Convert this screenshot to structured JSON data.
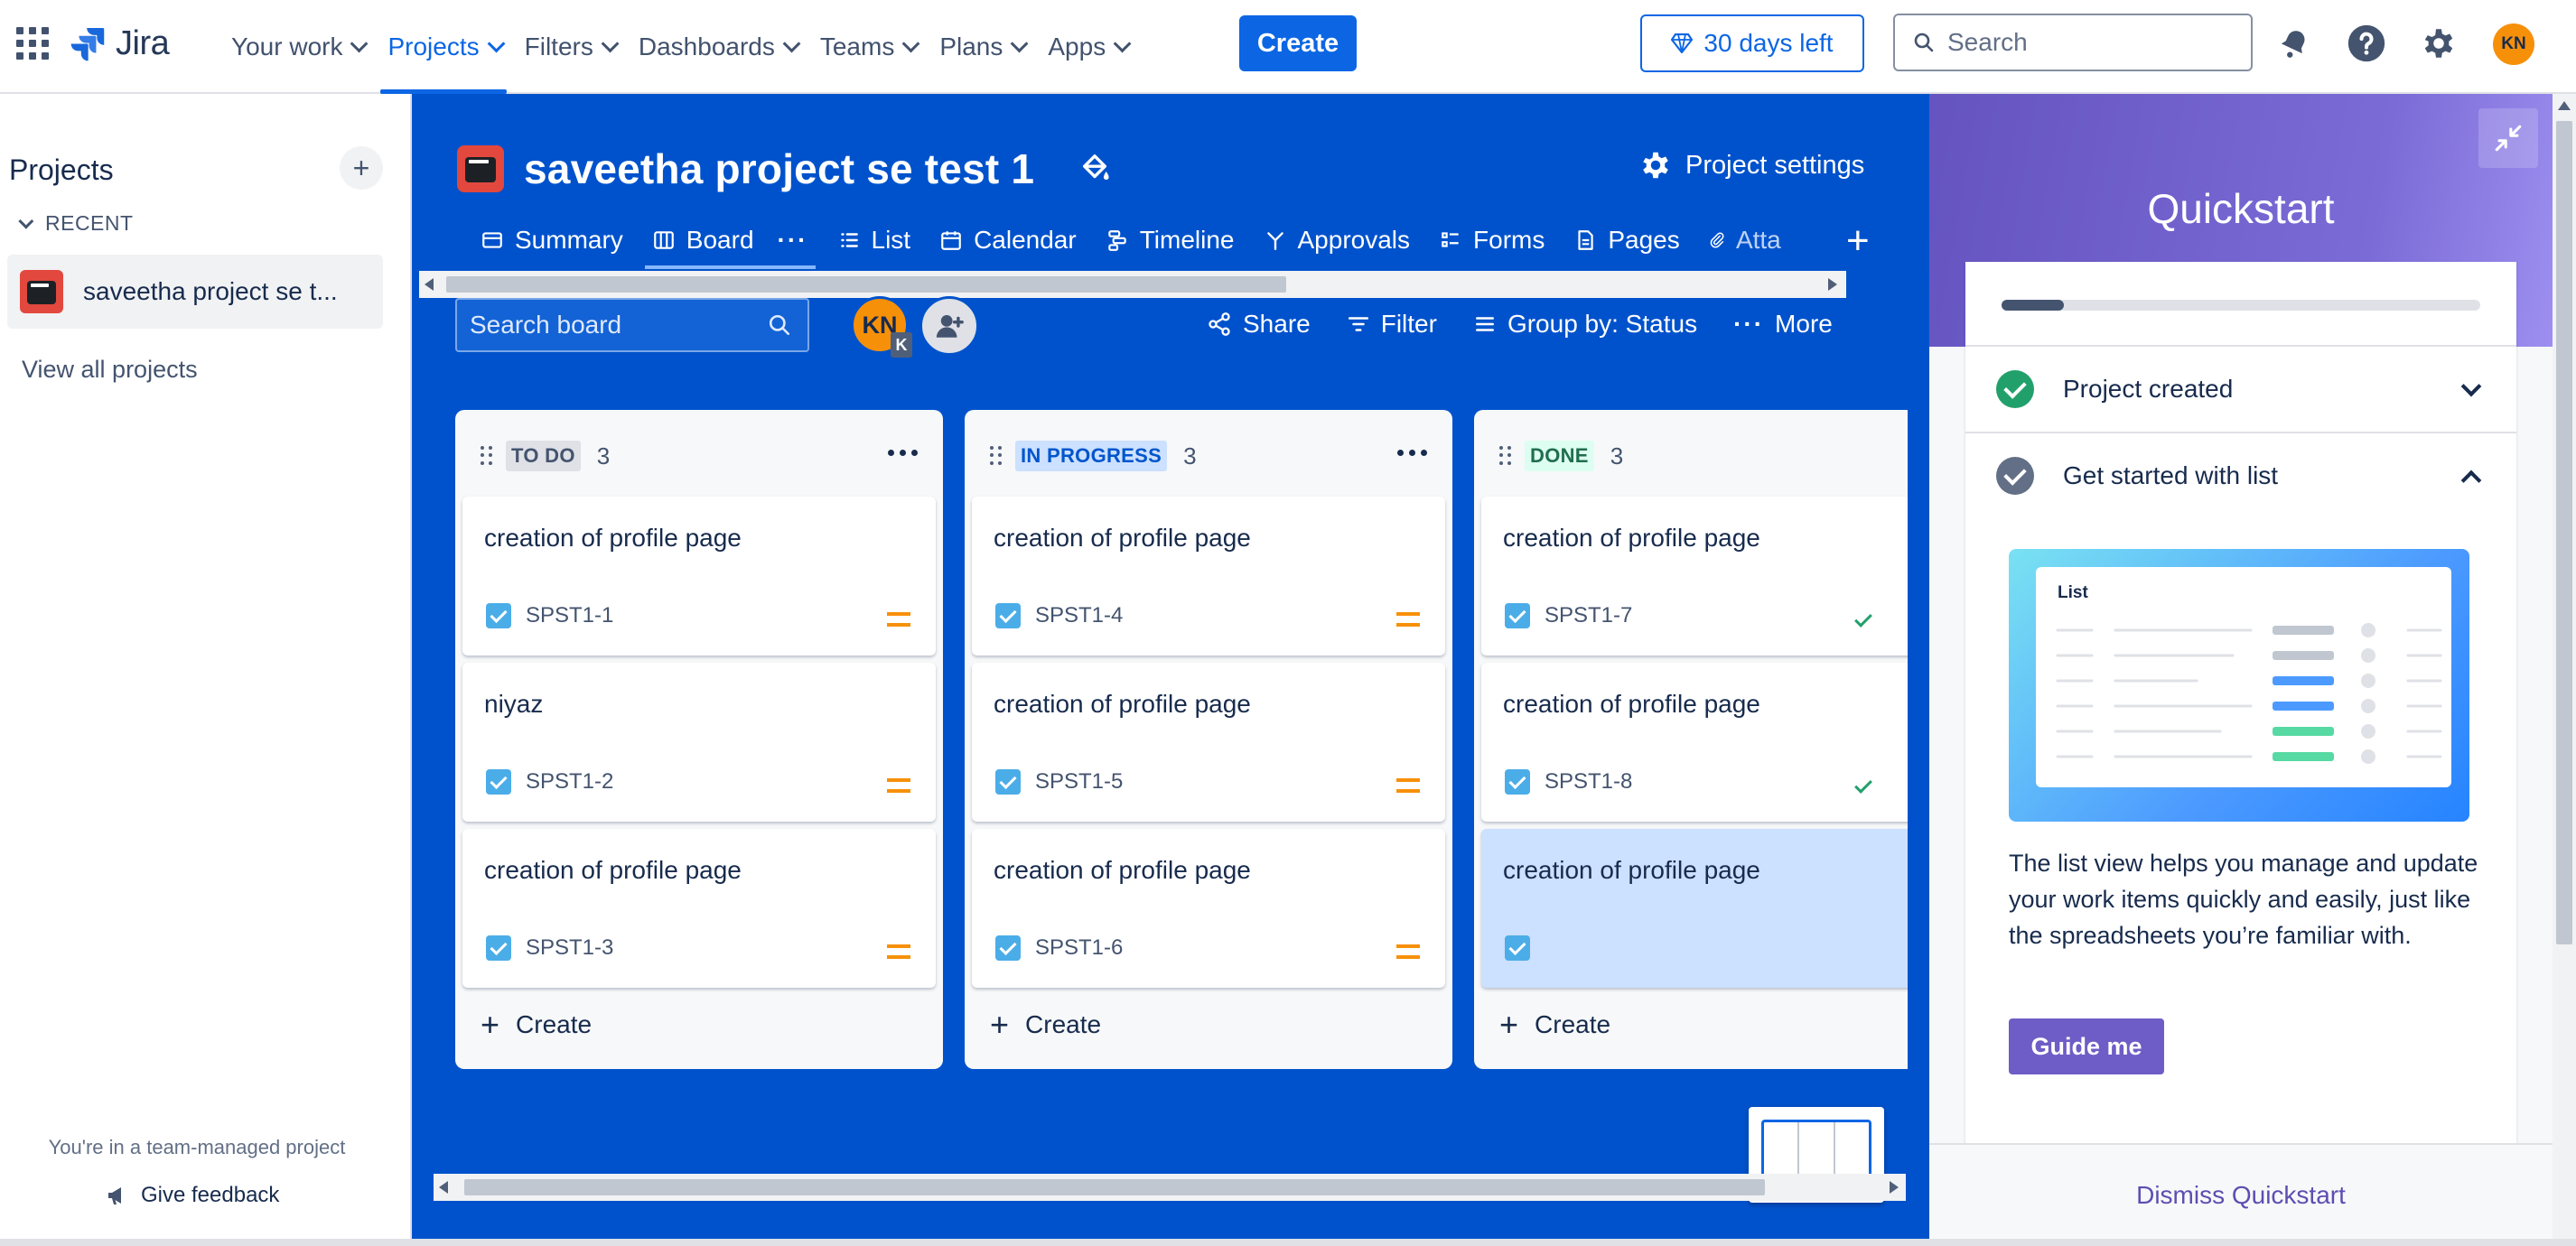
{
  "topnav": {
    "logo_text": "Jira",
    "items": [
      {
        "label": "Your work",
        "active": false
      },
      {
        "label": "Projects",
        "active": true
      },
      {
        "label": "Filters",
        "active": false
      },
      {
        "label": "Dashboards",
        "active": false
      },
      {
        "label": "Teams",
        "active": false
      },
      {
        "label": "Plans",
        "active": false
      },
      {
        "label": "Apps",
        "active": false
      }
    ],
    "create_label": "Create",
    "trial_label": "30 days left",
    "search_placeholder": "Search",
    "user_initials": "KN",
    "icons": [
      "app-switcher-icon",
      "notifications-icon",
      "help-icon",
      "settings-icon"
    ]
  },
  "sidebar": {
    "title": "Projects",
    "recent_label": "RECENT",
    "project_label": "saveetha project se t...",
    "view_all": "View all projects",
    "team_managed": "You're in a team-managed project",
    "feedback": "Give feedback"
  },
  "board": {
    "title": "saveetha project se test 1",
    "project_settings": "Project settings",
    "tabs": [
      {
        "label": "Summary",
        "icon": "globe-icon"
      },
      {
        "label": "Board",
        "icon": "board-icon",
        "active": true
      },
      {
        "label": "List",
        "icon": "list-icon"
      },
      {
        "label": "Calendar",
        "icon": "calendar-icon"
      },
      {
        "label": "Timeline",
        "icon": "timeline-icon"
      },
      {
        "label": "Approvals",
        "icon": "approvals-icon"
      },
      {
        "label": "Forms",
        "icon": "forms-icon"
      },
      {
        "label": "Pages",
        "icon": "pages-icon"
      },
      {
        "label": "Atta",
        "icon": "attachment-icon"
      }
    ],
    "search_placeholder": "Search board",
    "assignee_initials": "KN",
    "assignee_badge": "K",
    "actions": {
      "share": "Share",
      "filter": "Filter",
      "group_by": "Group by: Status",
      "more": "More"
    },
    "columns": [
      {
        "label": "TO DO",
        "count": "3",
        "label_bg": "#dfe1e6",
        "label_color": "#44546f",
        "cards": [
          {
            "title": "creation of profile page",
            "key": "SPST1-1",
            "marker": "priority"
          },
          {
            "title": "niyaz",
            "key": "SPST1-2",
            "marker": "priority"
          },
          {
            "title": "creation of profile page",
            "key": "SPST1-3",
            "marker": "priority"
          }
        ],
        "create_label": "Create"
      },
      {
        "label": "IN PROGRESS",
        "count": "3",
        "label_bg": "#cce0ff",
        "label_color": "#0055cc",
        "cards": [
          {
            "title": "creation of profile page",
            "key": "SPST1-4",
            "marker": "priority"
          },
          {
            "title": "creation of profile page",
            "key": "SPST1-5",
            "marker": "priority"
          },
          {
            "title": "creation of profile page",
            "key": "SPST1-6",
            "marker": "priority"
          }
        ],
        "create_label": "Create"
      },
      {
        "label": "DONE",
        "count": "3",
        "label_bg": "#dcfff1",
        "label_color": "#216e4e",
        "cards": [
          {
            "title": "creation of profile page",
            "key": "SPST1-7",
            "marker": "done"
          },
          {
            "title": "creation of profile page",
            "key": "SPST1-8",
            "marker": "done"
          },
          {
            "title": "creation of profile page",
            "key": "",
            "marker": "none",
            "selected": true
          }
        ],
        "create_label": "Create"
      }
    ]
  },
  "quickstart": {
    "title": "Quickstart",
    "progress": 0.13,
    "items": [
      {
        "label": "Project created",
        "status": "complete",
        "expanded": false
      },
      {
        "label": "Get started with list",
        "status": "current",
        "expanded": true
      }
    ],
    "illustration_title": "List",
    "description": "The list view helps you manage and update your work items quickly and easily, just like the spreadsheets you’re familiar with.",
    "guide_button": "Guide me",
    "dismiss": "Dismiss Quickstart"
  },
  "colors": {
    "brand_blue": "#0c66e4",
    "board_bg": "#0052cc",
    "quickstart_purple": "#6554c0",
    "priority_medium": "#f79009",
    "done_green": "#22a06b"
  }
}
